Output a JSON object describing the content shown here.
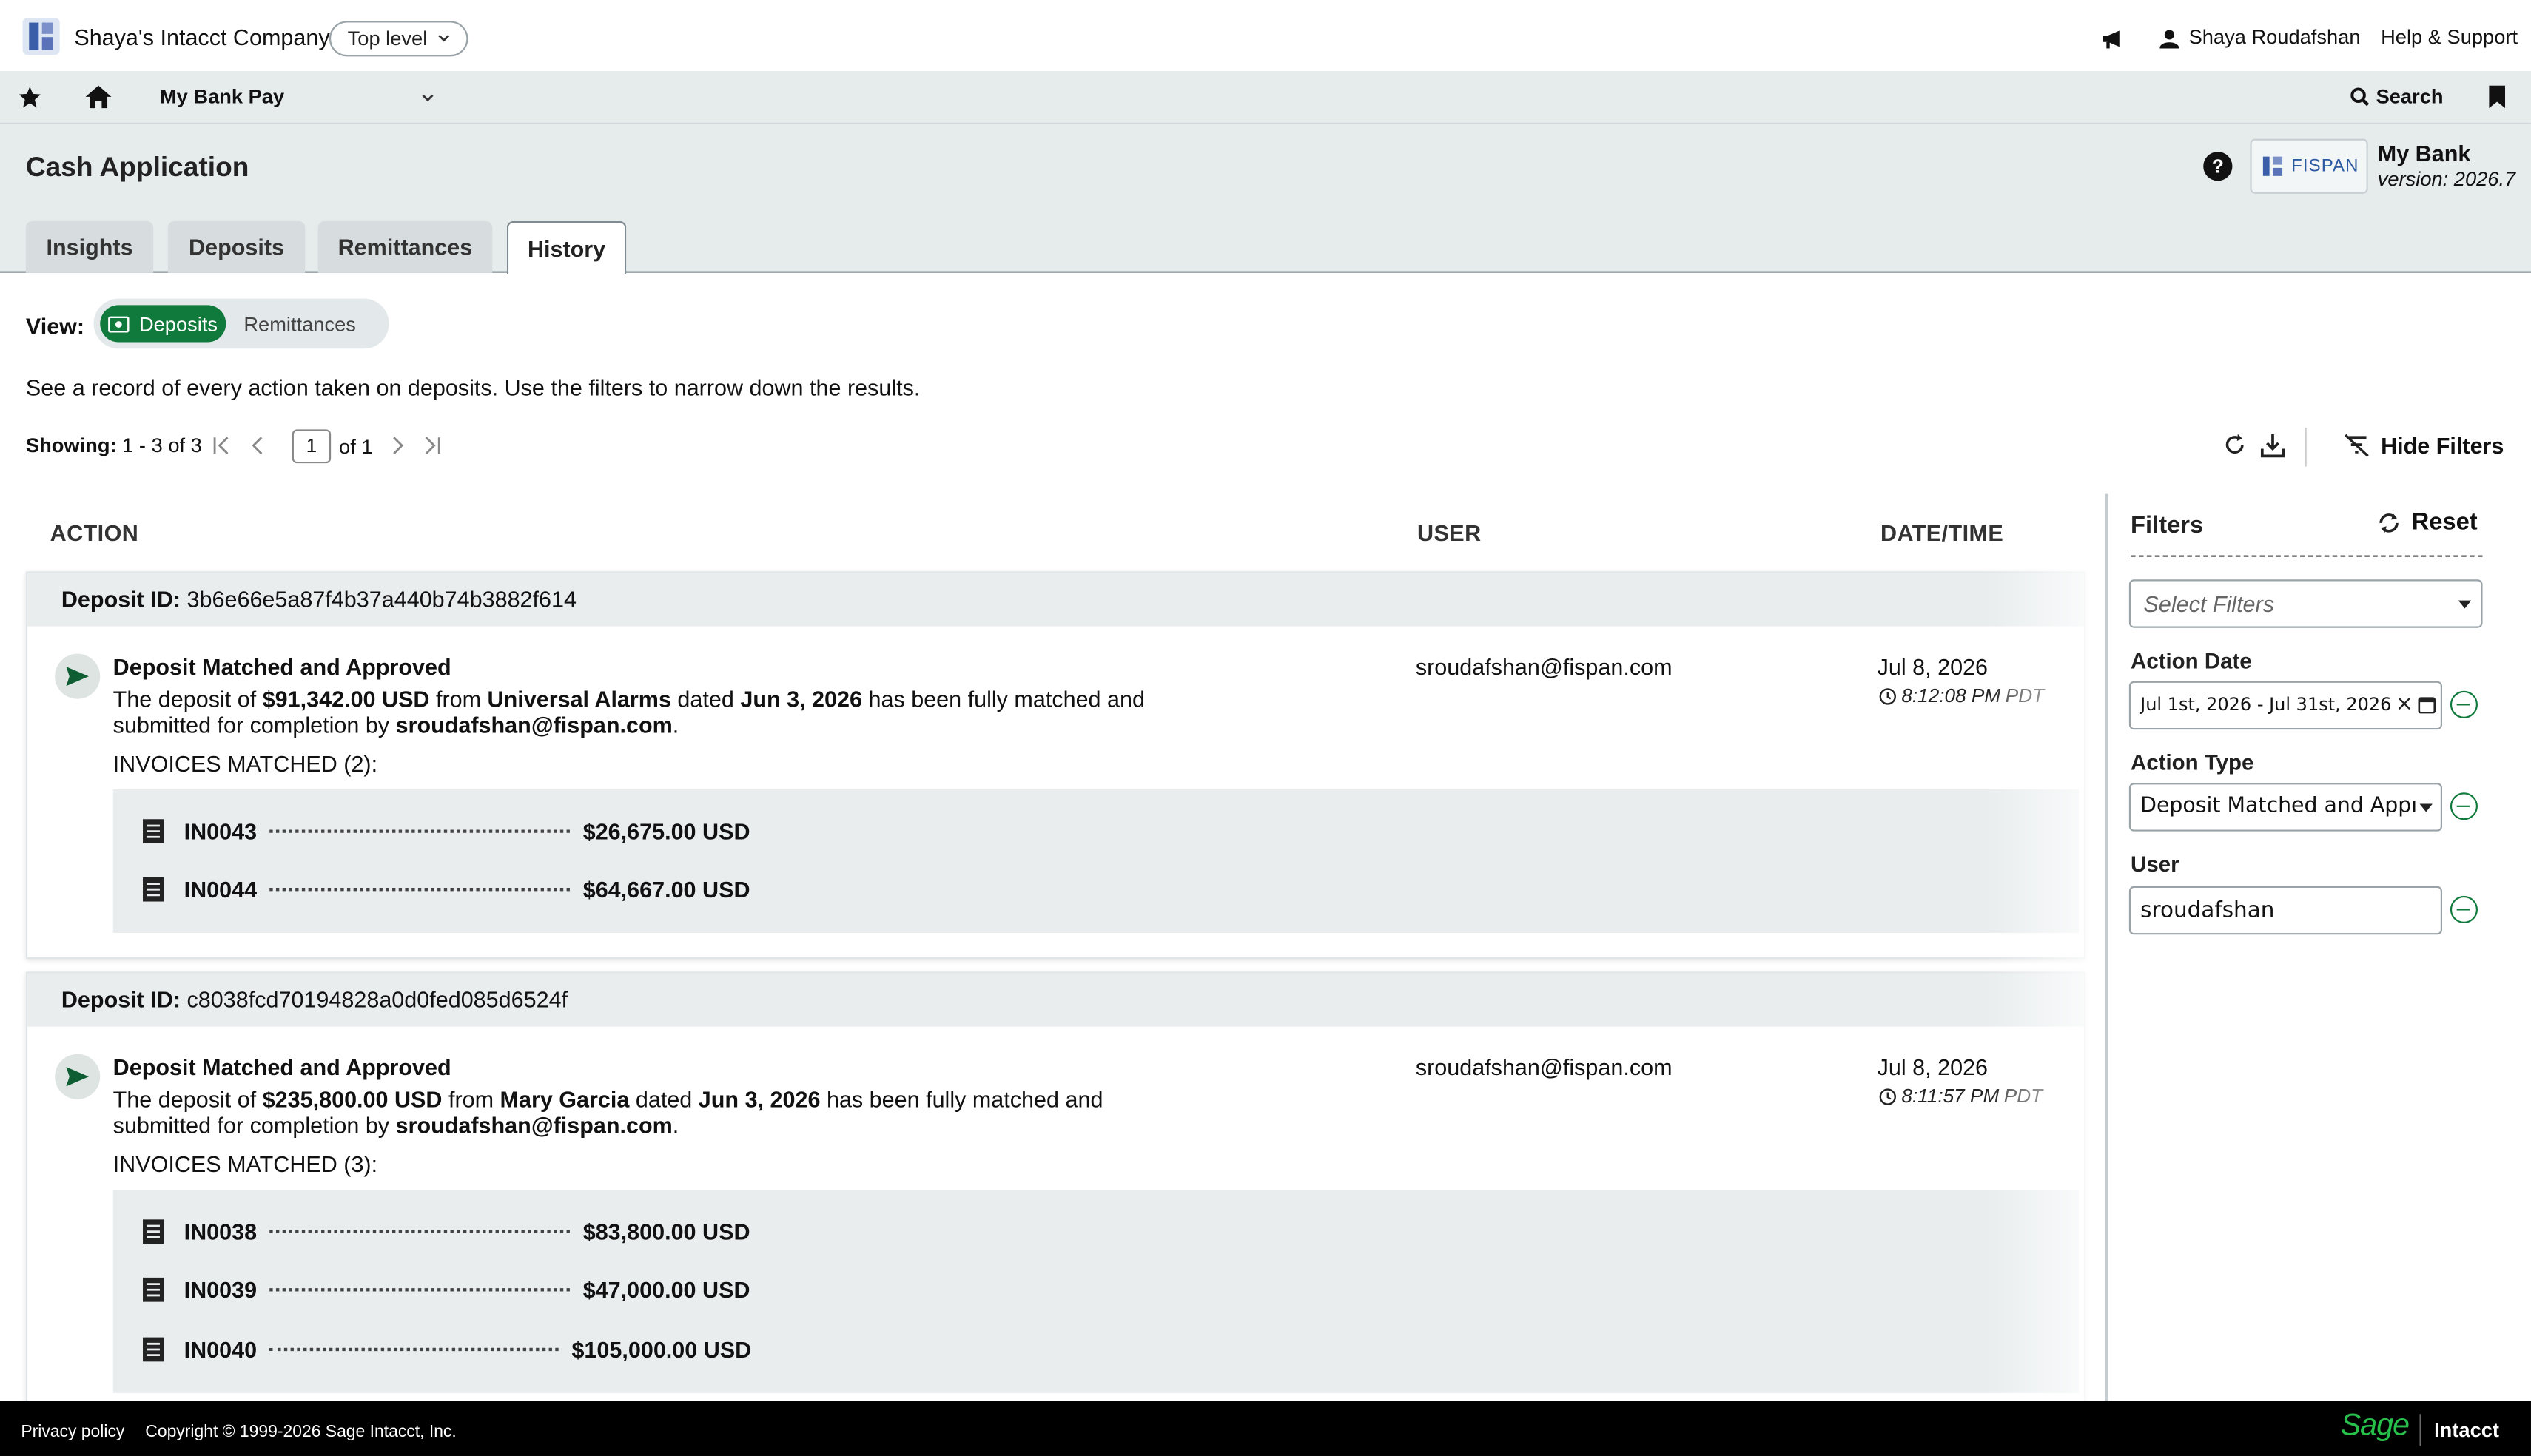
{
  "topbar": {
    "company": "Shaya's Intacct Company",
    "level": "Top level",
    "user": "Shaya Roudafshan",
    "help": "Help & Support"
  },
  "navbar": {
    "app": "My Bank Pay",
    "search": "Search"
  },
  "page": {
    "title": "Cash Application",
    "brand_name": "My Bank",
    "version": "version: 2026.7",
    "fispan_logo": "FISPAN",
    "tabs": [
      {
        "label": "Insights"
      },
      {
        "label": "Deposits"
      },
      {
        "label": "Remittances"
      },
      {
        "label": "History",
        "active": true
      }
    ]
  },
  "view": {
    "label": "View:",
    "options": [
      "Deposits",
      "Remittances"
    ],
    "selected": "Deposits"
  },
  "description": "See a record of every action taken on deposits. Use the filters to narrow down the results.",
  "pager": {
    "showing_label": "Showing:",
    "range": "1 - 3 of 3",
    "page": "1",
    "of": "of 1"
  },
  "toolbar": {
    "hide_filters": "Hide Filters"
  },
  "columns": {
    "action": "ACTION",
    "user": "USER",
    "datetime": "DATE/TIME"
  },
  "deposits": [
    {
      "id_label": "Deposit ID:",
      "id": "3b6e66e5a87f4b37a440b74b3882f614",
      "title": "Deposit Matched and Approved",
      "t1": "The deposit of ",
      "amount": "$91,342.00 USD",
      "t2": " from ",
      "payer": "Universal Alarms",
      "t3": " dated ",
      "date": "Jun 3, 2026",
      "t4": " has been fully matched and submitted for completion by ",
      "by": "sroudafshan@fispan.com",
      "t5": ".",
      "invoices_label": "INVOICES MATCHED (2):",
      "invoices": [
        {
          "id": "IN0043",
          "amount": "$26,675.00 USD"
        },
        {
          "id": "IN0044",
          "amount": "$64,667.00 USD"
        }
      ],
      "user": "sroudafshan@fispan.com",
      "action_date": "Jul 8, 2026",
      "action_time": "8:12:08 PM",
      "tz": "PDT"
    },
    {
      "id_label": "Deposit ID:",
      "id": "c8038fcd70194828a0d0fed085d6524f",
      "title": "Deposit Matched and Approved",
      "t1": "The deposit of ",
      "amount": "$235,800.00 USD",
      "t2": " from ",
      "payer": "Mary Garcia",
      "t3": " dated ",
      "date": "Jun 3, 2026",
      "t4": " has been fully matched and submitted for completion by ",
      "by": "sroudafshan@fispan.com",
      "t5": ".",
      "invoices_label": "INVOICES MATCHED (3):",
      "invoices": [
        {
          "id": "IN0038",
          "amount": "$83,800.00 USD"
        },
        {
          "id": "IN0039",
          "amount": "$47,000.00 USD"
        },
        {
          "id": "IN0040",
          "amount": "$105,000.00 USD"
        }
      ],
      "user": "sroudafshan@fispan.com",
      "action_date": "Jul 8, 2026",
      "action_time": "8:11:57 PM",
      "tz": "PDT"
    }
  ],
  "filters": {
    "title": "Filters",
    "reset": "Reset",
    "select_placeholder": "Select Filters",
    "action_date_label": "Action Date",
    "action_date_value": "Jul 1st, 2026 - Jul 31st, 2026",
    "action_type_label": "Action Type",
    "action_type_value": "Deposit Matched and Appı",
    "user_label": "User",
    "user_value": "sroudafshan"
  },
  "footer": {
    "privacy": "Privacy policy",
    "copyright": "Copyright © 1999-2026 Sage Intacct, Inc.",
    "sage": "Sage",
    "intacct": "Intacct"
  },
  "colors": {
    "accent_green": "#0f7a3b",
    "header_bg": "#e6ebec",
    "footer_bg": "#000000"
  }
}
